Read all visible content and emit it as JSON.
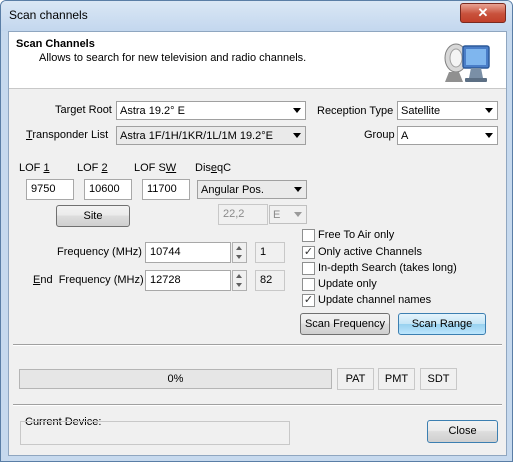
{
  "window": {
    "title": "Scan channels",
    "close_glyph": "✕"
  },
  "header": {
    "title": "Scan Channels",
    "subtitle": "Allows to search for new television and radio channels.",
    "icon": "monitor-satellite-icon"
  },
  "target_root": {
    "label": "Target Root",
    "value": "Astra 19.2° E"
  },
  "transponder_list": {
    "label_pre": "",
    "label_u": "T",
    "label_post": "ransponder List",
    "value": "Astra 1F/1H/1KR/1L/1M 19.2°E"
  },
  "reception_type": {
    "label": "Reception Type",
    "value": "Satellite"
  },
  "group": {
    "label": "Group",
    "value": "A"
  },
  "lof1": {
    "label_pre": "LOF ",
    "label_u": "1",
    "value": "9750"
  },
  "lof2": {
    "label_pre": "LOF ",
    "label_u": "2",
    "value": "10600"
  },
  "lofsw": {
    "label_pre": "LOF S",
    "label_u": "W",
    "value": "11700"
  },
  "diseqc": {
    "label_pre": "Dis",
    "label_u": "e",
    "label_post": "qC",
    "value": "Angular Pos."
  },
  "site_button": "Site",
  "position": {
    "value": "22,2",
    "direction": "E"
  },
  "frequency": {
    "label": "Frequency (MHz)",
    "value": "10744",
    "count": "1"
  },
  "end_frequency": {
    "label_u": "E",
    "label_post": "nd  Frequency (MHz)",
    "value": "12728",
    "count": "82"
  },
  "options": [
    {
      "label": "Free To Air only",
      "checked": false
    },
    {
      "label": "Only active Channels",
      "checked": true
    },
    {
      "label": "In-depth Search (takes long)",
      "checked": false
    },
    {
      "label": "Update only",
      "checked": false
    },
    {
      "label": "Update channel names",
      "checked": true
    }
  ],
  "scan_frequency_button": "Scan Frequency",
  "scan_range_button": "Scan Range",
  "progress": {
    "value": 0,
    "text": "0%"
  },
  "pat_button": "PAT",
  "pmt_button": "PMT",
  "sdt_button": "SDT",
  "current_device": {
    "label": "Current Device:",
    "value": ""
  },
  "close_button": "Close",
  "colors": {
    "titlebar": "#c3d7ee",
    "client": "#f0f0f0",
    "close_x": "#c8513c",
    "hot_button": "#c4e5f6",
    "focus_border": "#3c7fb1"
  }
}
